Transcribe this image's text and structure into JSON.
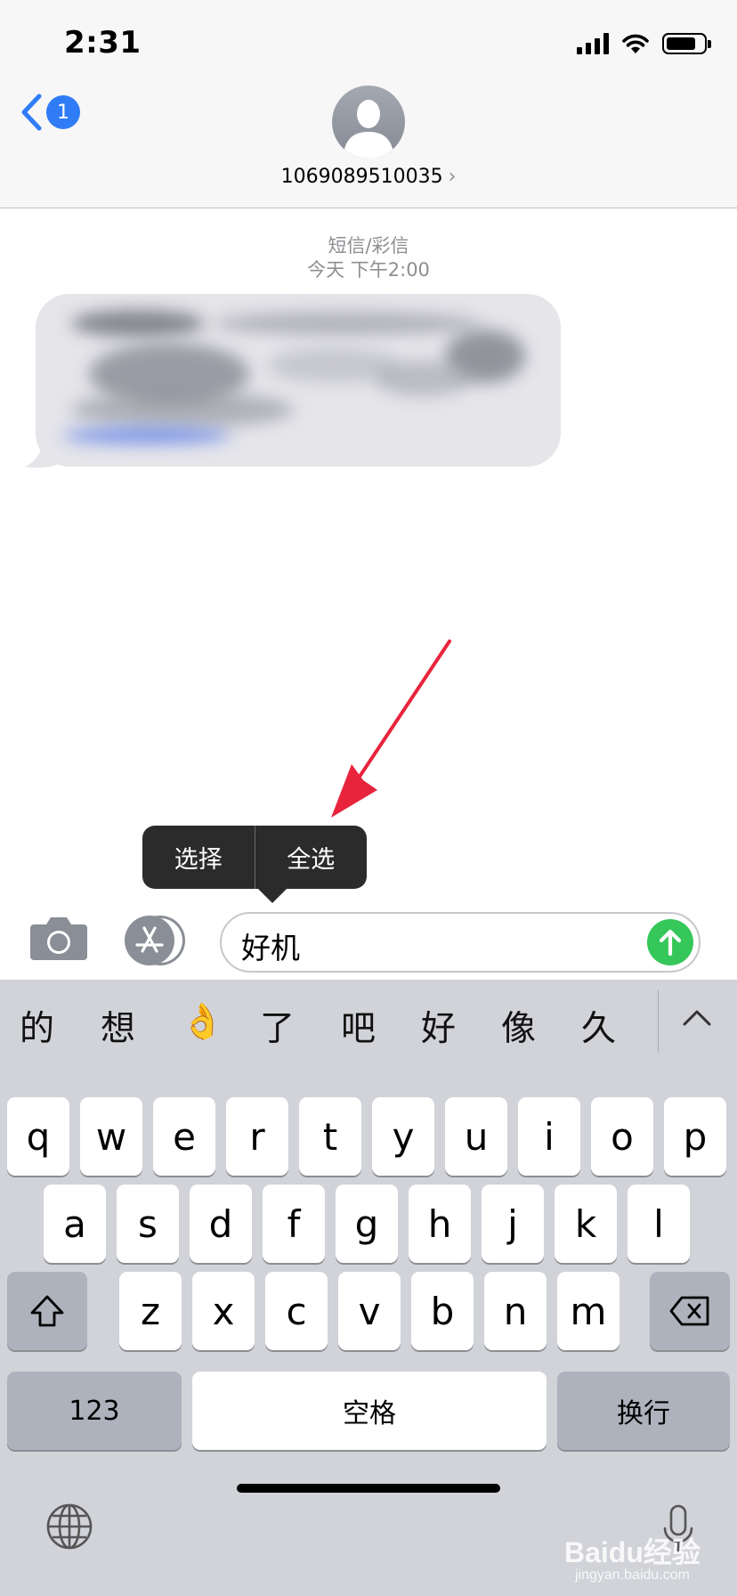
{
  "status_bar": {
    "time": "2:31",
    "battery_level": 0.8
  },
  "nav": {
    "back_badge": "1",
    "contact_name": "1069089510035",
    "contact_chevron": "›"
  },
  "conversation": {
    "message_type": "短信/彩信",
    "timestamp": "今天 下午2:00"
  },
  "annotation": {
    "arrow_color": "#e8243c"
  },
  "edit_menu": {
    "select": "选择",
    "select_all": "全选"
  },
  "composer": {
    "text": "好机",
    "send_color": "#35c759"
  },
  "keyboard": {
    "candidates": [
      "的",
      "想",
      "👌",
      "了",
      "吧",
      "好",
      "像",
      "久"
    ],
    "row1": [
      "q",
      "w",
      "e",
      "r",
      "t",
      "y",
      "u",
      "i",
      "o",
      "p"
    ],
    "row2": [
      "a",
      "s",
      "d",
      "f",
      "g",
      "h",
      "j",
      "k",
      "l"
    ],
    "row3": [
      "z",
      "x",
      "c",
      "v",
      "b",
      "n",
      "m"
    ],
    "numbers_key": "123",
    "space_key": "空格",
    "return_key": "换行"
  },
  "watermark": {
    "brand": "Baidu经验",
    "url": "jingyan.baidu.com"
  }
}
